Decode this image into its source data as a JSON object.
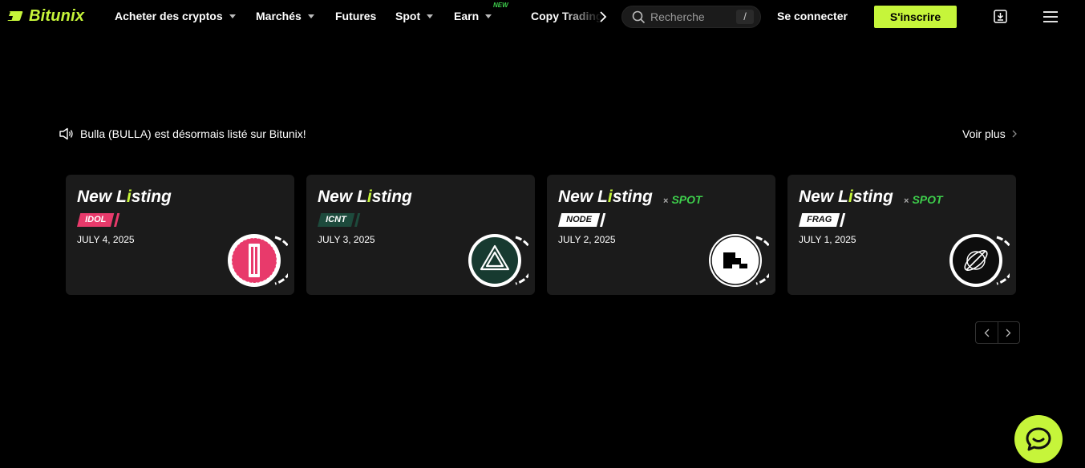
{
  "brand": {
    "name": "Bitunix",
    "accent": "#c6f53a"
  },
  "nav": {
    "items": [
      {
        "label": "Acheter des cryptos",
        "caret": true
      },
      {
        "label": "Marchés",
        "caret": true
      },
      {
        "label": "Futures",
        "caret": false
      },
      {
        "label": "Spot",
        "caret": true
      },
      {
        "label": "Earn",
        "caret": true,
        "badge": "NEW"
      },
      {
        "label": "Copy Trading",
        "caret": false
      }
    ],
    "search": {
      "placeholder": "Recherche",
      "shortcut": "/"
    },
    "login_label": "Se connecter",
    "signup_label": "S'inscrire",
    "icons": [
      "download-icon",
      "menu-icon"
    ]
  },
  "announcement": {
    "text": "Bulla (BULLA) est désormais listé sur Bitunix!",
    "more_label": "Voir plus"
  },
  "cards": [
    {
      "title_a": "New L",
      "title_b": "i",
      "title_c": "sting",
      "spot": "",
      "tag": "IDOL",
      "tag_color": "#e83a6b",
      "tag_text_color": "#ffffff",
      "date": "JULY 4, 2025",
      "coin_icon": "idol-coin-icon"
    },
    {
      "title_a": "New L",
      "title_b": "i",
      "title_c": "sting",
      "spot": "",
      "tag": "ICNT",
      "tag_color": "#1d4a3c",
      "tag_text_color": "#ffffff",
      "date": "JULY 3, 2025",
      "coin_icon": "icnt-coin-icon"
    },
    {
      "title_a": "New L",
      "title_b": "i",
      "title_c": "sting",
      "spot_x": "×",
      "spot": "SPOT",
      "tag": "NODE",
      "tag_color": "#ffffff",
      "tag_text_color": "#111111",
      "date": "JULY 2, 2025",
      "coin_icon": "node-coin-icon"
    },
    {
      "title_a": "New L",
      "title_b": "i",
      "title_c": "sting",
      "spot_x": "×",
      "spot": "SPOT",
      "tag": "FRAG",
      "tag_color": "#ffffff",
      "tag_text_color": "#111111",
      "date": "JULY 1, 2025",
      "coin_icon": "frag-coin-icon"
    }
  ],
  "carousel": {
    "prev": "chevron-left-icon",
    "next": "chevron-right-icon"
  },
  "chat": {
    "icon": "chat-icon"
  }
}
